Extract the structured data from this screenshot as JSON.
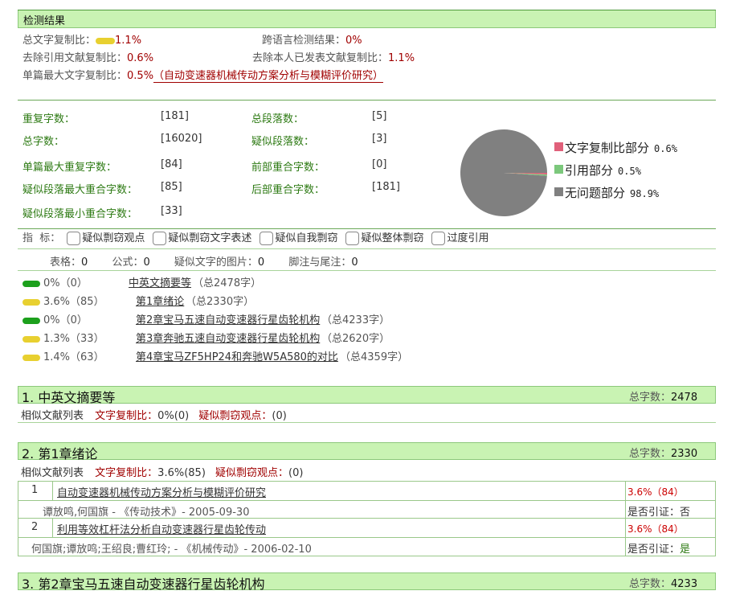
{
  "header": {
    "title": "检测结果"
  },
  "summary": {
    "total_copy_label": "总文字复制比：",
    "total_copy_value": "1.1%",
    "cross_lang_label": "跨语言检测结果：",
    "cross_lang_value": "0%",
    "exclude_ref_label": "去除引用文献复制比：",
    "exclude_ref_value": "0.6%",
    "exclude_self_label": "去除本人已发表文献复制比：",
    "exclude_self_value": "1.1%",
    "single_max_label": "单篇最大文字复制比：",
    "single_max_value": "0.5%",
    "single_max_doc": "（自动变速器机械传动方案分析与模糊评价研究）"
  },
  "stats": {
    "dup_chars_label": "重复字数：",
    "dup_chars_value": "[181]",
    "total_paras_label": "总段落数：",
    "total_paras_value": "[5]",
    "total_chars_label": "总字数：",
    "total_chars_value": "[16020]",
    "sim_paras_label": "疑似段落数：",
    "sim_paras_value": "[3]",
    "single_max_dup_label": "单篇最大重复字数：",
    "single_max_dup_value": "[84]",
    "front_overlap_label": "前部重合字数：",
    "front_overlap_value": "[0]",
    "sim_para_max_label": "疑似段落最大重合字数：",
    "sim_para_max_value": "[85]",
    "back_overlap_label": "后部重合字数：",
    "back_overlap_value": "[181]",
    "sim_para_min_label": "疑似段落最小重合字数：",
    "sim_para_min_value": "[33]"
  },
  "chart_data": {
    "type": "pie",
    "slices": [
      {
        "label": "文字复制比部分",
        "value": 0.6,
        "display": "0.6%",
        "color": "#e0607a"
      },
      {
        "label": "引用部分",
        "value": 0.5,
        "display": "0.5%",
        "color": "#7cc87c"
      },
      {
        "label": "无问题部分",
        "value": 98.9,
        "display": "98.9%",
        "color": "#808080"
      }
    ]
  },
  "indicators": {
    "label": "指  标：",
    "items": [
      "疑似剽窃观点",
      "疑似剽窃文字表述",
      "疑似自我剽窃",
      "疑似整体剽窃",
      "过度引用"
    ]
  },
  "counts": {
    "table_label": "表格：",
    "table_value": "0",
    "formula_label": "公式：",
    "formula_value": "0",
    "image_label": "疑似文字的图片：",
    "image_value": "0",
    "footnote_label": "脚注与尾注：",
    "footnote_value": "0"
  },
  "chapters": [
    {
      "bar": "green",
      "pct": "0%（0）",
      "title": "中英文摘要等",
      "total": "（总2478字）"
    },
    {
      "bar": "yellow",
      "pct": "3.6%（85）",
      "title": "第1章绪论",
      "total": "（总2330字）"
    },
    {
      "bar": "green",
      "pct": "0%（0）",
      "title": "第2章宝马五速自动变速器行星齿轮机构",
      "total": "（总4233字）"
    },
    {
      "bar": "yellow",
      "pct": "1.3%（33）",
      "title": "第3章奔驰五速自动变速器行星齿轮机构",
      "total": "（总2620字）"
    },
    {
      "bar": "yellow",
      "pct": "1.4%（63）",
      "title": "第4章宝马ZF5HP24和奔驰W5A580的对比",
      "total": "（总4359字）"
    }
  ],
  "sections": [
    {
      "title": "1. 中英文摘要等",
      "count_label": "总字数：",
      "count_value": "2478",
      "list_label": "相似文献列表",
      "copy_label": "文字复制比：",
      "copy_value": "0%(0)",
      "plag_label": "疑似剽窃观点：",
      "plag_value": "(0)"
    },
    {
      "title": "2. 第1章绪论",
      "count_label": "总字数：",
      "count_value": "2330",
      "list_label": "相似文献列表",
      "copy_label": "文字复制比：",
      "copy_value": "3.6%(85)",
      "plag_label": "疑似剽窃观点：",
      "plag_value": "(0)",
      "refs": [
        {
          "no": "1",
          "title": "自动变速器机械传动方案分析与模糊评价研究",
          "pct": "3.6%（84）",
          "meta": "谭放鸣,何国旗 - 《传动技术》- 2005-09-30",
          "cite_label": "是否引证：",
          "cite_value": "否"
        },
        {
          "no": "2",
          "title": "利用等效杠杆法分析自动变速器行星齿轮传动",
          "pct": "3.6%（84）",
          "meta": "何国旗;谭放鸣;王绍良;曹红玲; - 《机械传动》- 2006-02-10",
          "cite_label": "是否引证：",
          "cite_value": "是"
        }
      ]
    },
    {
      "title": "3. 第2章宝马五速自动变速器行星齿轮机构",
      "count_label": "总字数：",
      "count_value": "4233"
    }
  ]
}
